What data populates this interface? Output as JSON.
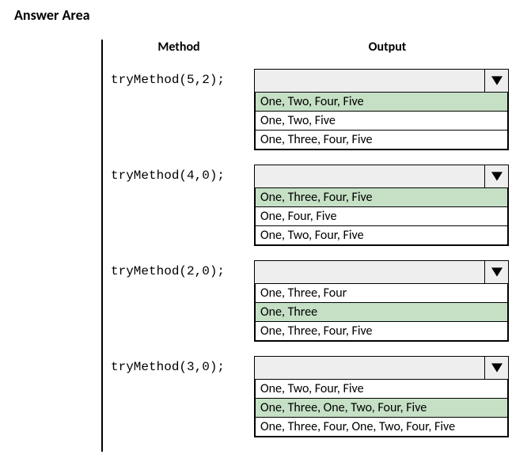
{
  "title": "Answer Area",
  "headers": {
    "method": "Method",
    "output": "Output"
  },
  "rows": [
    {
      "method": "tryMethod(5,2);",
      "selected": "",
      "options": [
        {
          "text": "One, Two, Four, Five",
          "highlight": true
        },
        {
          "text": "One, Two, Five",
          "highlight": false
        },
        {
          "text": "One, Three, Four, Five",
          "highlight": false
        }
      ]
    },
    {
      "method": "tryMethod(4,0);",
      "selected": "",
      "options": [
        {
          "text": "One, Three, Four, Five",
          "highlight": true
        },
        {
          "text": "One, Four, Five",
          "highlight": false
        },
        {
          "text": "One, Two, Four, Five",
          "highlight": false
        }
      ]
    },
    {
      "method": "tryMethod(2,0);",
      "selected": "",
      "options": [
        {
          "text": "One, Three, Four",
          "highlight": false
        },
        {
          "text": "One, Three",
          "highlight": true
        },
        {
          "text": "One, Three, Four, Five",
          "highlight": false
        }
      ]
    },
    {
      "method": "tryMethod(3,0);",
      "selected": "",
      "options": [
        {
          "text": "One, Two, Four, Five",
          "highlight": false
        },
        {
          "text": "One, Three, One, Two, Four, Five",
          "highlight": true
        },
        {
          "text": "One, Three, Four, One, Two, Four, Five",
          "highlight": false
        }
      ]
    }
  ]
}
